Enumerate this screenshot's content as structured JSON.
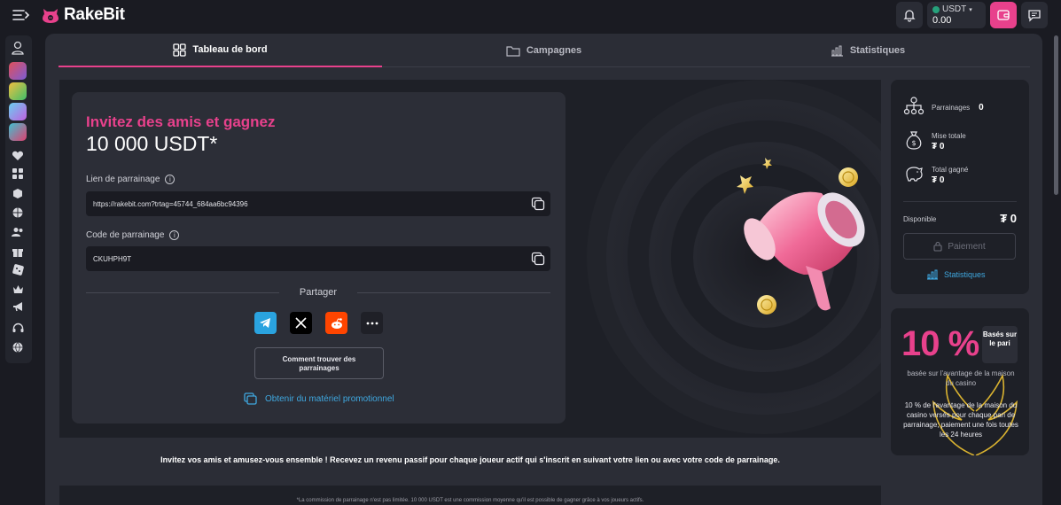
{
  "header": {
    "logo_text": "RakeBit",
    "currency": "USDT",
    "balance": "0.00",
    "colors": {
      "accent": "#e8418c",
      "link": "#3fa8e0"
    }
  },
  "sidebar": {
    "items": [
      {
        "icon": "user-icon"
      },
      {
        "icon": "game-thumbnail"
      },
      {
        "icon": "game-thumbnail"
      },
      {
        "icon": "game-thumbnail"
      },
      {
        "icon": "game-thumbnail"
      },
      {
        "icon": "hearts-icon"
      },
      {
        "icon": "grid-icon"
      },
      {
        "icon": "cube-icon"
      },
      {
        "icon": "basketball-icon"
      },
      {
        "icon": "users-icon"
      },
      {
        "icon": "gift-icon"
      },
      {
        "icon": "dice-icon"
      },
      {
        "icon": "crown-icon"
      },
      {
        "icon": "megaphone-icon"
      },
      {
        "icon": "headphones-icon"
      },
      {
        "icon": "globe-icon"
      }
    ]
  },
  "tabs": [
    {
      "label": "Tableau de bord",
      "active": true
    },
    {
      "label": "Campagnes",
      "active": false
    },
    {
      "label": "Statistiques",
      "active": false
    }
  ],
  "invite": {
    "title": "Invitez des amis et gagnez",
    "amount": "10 000 USDT*",
    "link_label": "Lien de parrainage",
    "link_value": "https://rakebit.com?trtag=45744_684aa6bc94396",
    "code_label": "Code de parrainage",
    "code_value": "CKUHPH9T",
    "share_label": "Partager",
    "share_buttons": [
      "telegram-icon",
      "x-icon",
      "reddit-icon",
      "more-icon"
    ],
    "how_to_label": "Comment trouver des parrainages",
    "promo_link": "Obtenir du matériel promotionnel"
  },
  "stats": {
    "referrals_label": "Parrainages",
    "referrals_value": "0",
    "total_bet_label": "Mise totale",
    "total_bet_value": "₮ 0",
    "total_won_label": "Total gagné",
    "total_won_value": "₮ 0",
    "available_label": "Disponible",
    "available_value": "₮ 0",
    "payment_label": "Paiement",
    "stats_link": "Statistiques"
  },
  "promo": {
    "percent": "10 %",
    "badge": "Basés sur le pari",
    "sub": "basée sur l'avantage de la maison du casino",
    "desc": "10 % de l'avantage de la maison du casino versés pour chaque pari de parrainage; paiement une fois toutes les 24 heures"
  },
  "footer": {
    "message": "Invitez vos amis et amusez-vous ensemble ! Recevez un revenu passif pour chaque joueur actif qui s'inscrit en suivant votre lien ou avec votre code de parrainage.",
    "disclaimer": "*La commission de parrainage n'est pas limitée. 10 000 USDT est une commission moyenne qu'il est possible de gagner grâce à vos joueurs actifs."
  }
}
